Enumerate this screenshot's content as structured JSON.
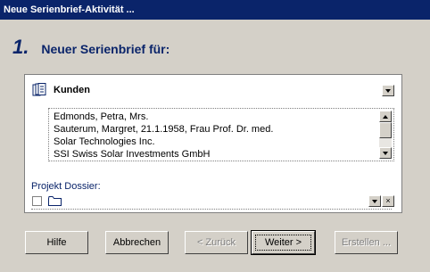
{
  "window": {
    "title": "Neue Serienbrief-Aktivität ..."
  },
  "step": {
    "number": "1.",
    "text": "Neuer Serienbrief für:"
  },
  "panel": {
    "category": "Kunden",
    "list": [
      "Edmonds, Petra, Mrs.",
      "Sauterum, Margret, 21.1.1958, Frau Prof. Dr. med.",
      "Solar Technologies Inc.",
      "SSI Swiss Solar Investments GmbH"
    ],
    "dossier_label": "Projekt Dossier:",
    "clear_glyph": "×"
  },
  "buttons": {
    "help": "Hilfe",
    "cancel": "Abbrechen",
    "back": "< Zurück",
    "next": "Weiter >",
    "finish": "Erstellen ..."
  },
  "colors": {
    "title_bar": "#0a246a",
    "accent_text": "#0a246a",
    "face": "#d4d0c8"
  }
}
